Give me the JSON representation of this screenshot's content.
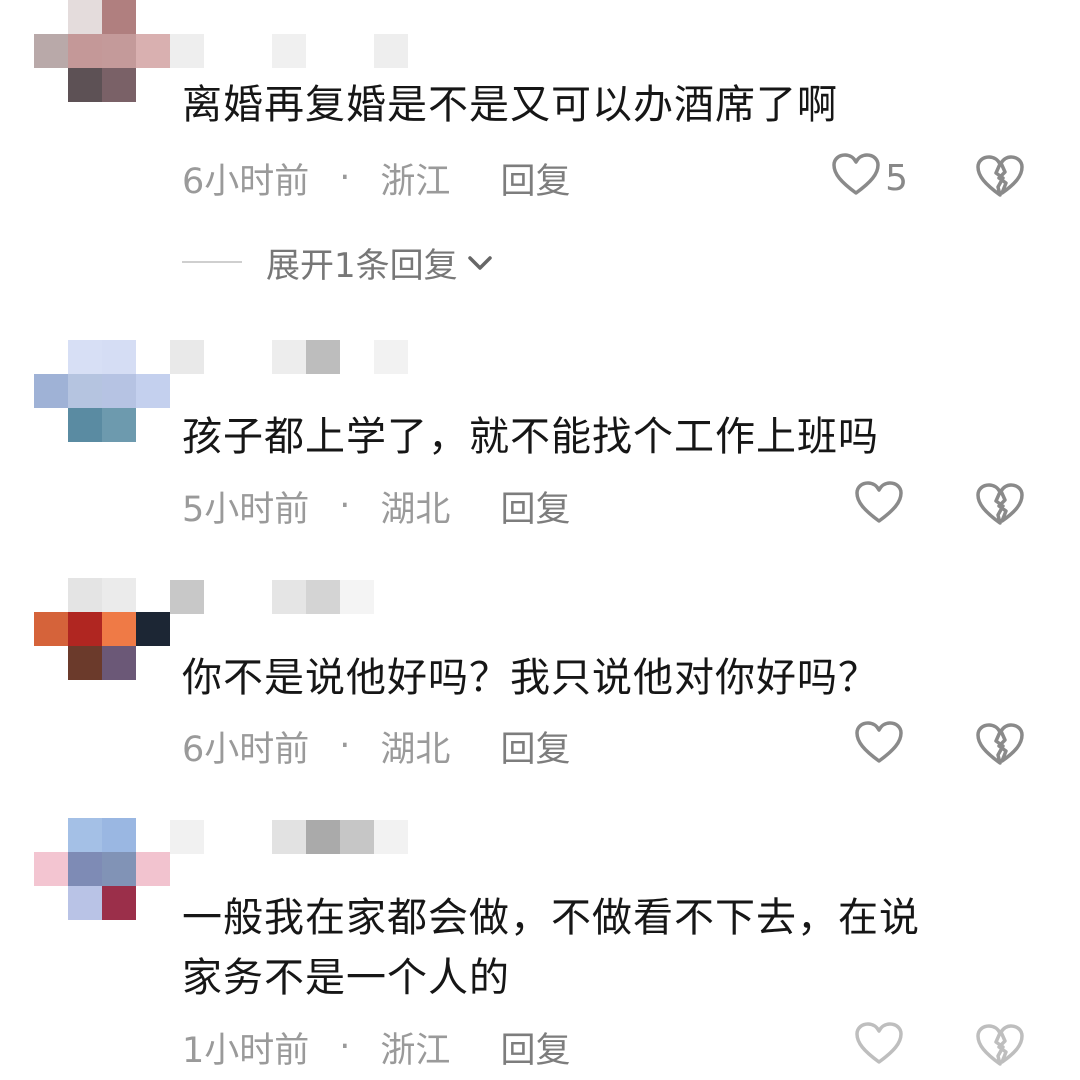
{
  "comments": [
    {
      "content": "离婚再复婚是不是又可以办酒席了啊",
      "time": "6小时前",
      "separator": "·",
      "location": "浙江",
      "reply_label": "回复",
      "like_count": "5",
      "avatar_colors": [
        "#ffffff",
        "#e4dcdc",
        "#b07f7f",
        "#ffffff",
        "#b9a9a9",
        "#c49898",
        "#c49a9a",
        "#d9b0b0",
        "#ffffff",
        "#5d5155",
        "#7a6167",
        "#ffffff"
      ],
      "username_colors": [
        "#eeeeee",
        "#ffffff",
        "#f0f0f0",
        "#ffffff",
        "#ffffff",
        "#eeeeee"
      ],
      "expand_label": "展开1条回复"
    },
    {
      "content": "孩子都上学了，就不能找个工作上班吗",
      "time": "5小时前",
      "separator": "·",
      "location": "湖北",
      "reply_label": "回复",
      "like_count": "",
      "avatar_colors": [
        "#ffffff",
        "#d7dff5",
        "#d5ddf4",
        "#ffffff",
        "#9fb2d6",
        "#b5c4e0",
        "#b6c3e3",
        "#c4d0ee",
        "#ffffff",
        "#5a8ba2",
        "#6d9aae",
        "#ffffff"
      ],
      "username_colors": [
        "#e9e9e9",
        "#ffffff",
        "#ededed",
        "#bdbdbd",
        "#ffffff",
        "#f2f2f2"
      ]
    },
    {
      "content": "你不是说他好吗？我只说他对你好吗？",
      "time": "6小时前",
      "separator": "·",
      "location": "湖北",
      "reply_label": "回复",
      "like_count": "",
      "avatar_colors": [
        "#ffffff",
        "#e4e4e4",
        "#ebebeb",
        "#ffffff",
        "#d5633a",
        "#b02621",
        "#ef7a46",
        "#1c2634",
        "#ffffff",
        "#6b3a2b",
        "#6b5877",
        "#ffffff"
      ],
      "username_colors": [
        "#c8c8c8",
        "#ffffff",
        "#e5e5e5",
        "#d4d4d4",
        "#f4f4f4",
        "#ffffff"
      ]
    },
    {
      "content": "一般我在家都会做，不做看不下去，在说家务不是一个人的",
      "content_line1": "一般我在家都会做，不做看不下去，在说",
      "content_line2": "家务不是一个人的",
      "time": "1小时前",
      "separator": "·",
      "location": "浙江",
      "reply_label": "回复",
      "like_count": "",
      "avatar_colors": [
        "#ffffff",
        "#a4c0e6",
        "#9ab7e2",
        "#ffffff",
        "#f3c5d1",
        "#7e8bb5",
        "#8193b6",
        "#f2c3cf",
        "#ffffff",
        "#b9c3e6",
        "#9b2f4a",
        "#ffffff"
      ],
      "username_colors": [
        "#f1f1f1",
        "#ffffff",
        "#e2e2e2",
        "#aaaaaa",
        "#c6c6c6",
        "#f2f2f2"
      ]
    }
  ],
  "colors": {
    "text_primary": "#161616",
    "text_secondary": "#9a9a9a",
    "icon_gray": "#8a8a8a"
  },
  "icons": {
    "like": "heart-outline",
    "dislike": "broken-heart",
    "expand": "chevron-down"
  }
}
